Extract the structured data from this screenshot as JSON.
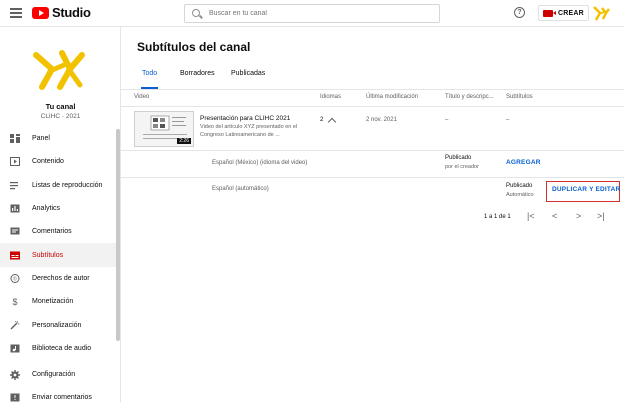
{
  "topbar": {
    "logo_text": "Studio",
    "search_placeholder": "Buscar en tu canal",
    "help_glyph": "?",
    "create_label": "CREAR"
  },
  "sidebar": {
    "channel_name": "Tu canal",
    "channel_handle": "CLIHC · 2021",
    "items": [
      {
        "label": "Panel",
        "icon": "dashboard-icon",
        "active": false
      },
      {
        "label": "Contenido",
        "icon": "content-icon",
        "active": false
      },
      {
        "label": "Listas de reproducción",
        "icon": "playlist-icon",
        "active": false
      },
      {
        "label": "Analytics",
        "icon": "analytics-icon",
        "active": false
      },
      {
        "label": "Comentarios",
        "icon": "comments-icon",
        "active": false
      },
      {
        "label": "Subtítulos",
        "icon": "subtitles-icon",
        "active": true
      },
      {
        "label": "Derechos de autor",
        "icon": "copyright-icon",
        "active": false
      },
      {
        "label": "Monetización",
        "icon": "monetization-icon",
        "active": false
      },
      {
        "label": "Personalización",
        "icon": "customization-icon",
        "active": false
      },
      {
        "label": "Biblioteca de audio",
        "icon": "audio-library-icon",
        "active": false
      },
      {
        "label": "Configuración",
        "icon": "settings-icon",
        "active": false
      },
      {
        "label": "Enviar comentarios",
        "icon": "feedback-icon",
        "active": false
      }
    ]
  },
  "main": {
    "title": "Subtítulos del canal",
    "tabs": [
      "Todo",
      "Borradores",
      "Publicadas"
    ],
    "columns": {
      "video": "Video",
      "languages": "Idiomas",
      "last_modified": "Última modificación",
      "title_desc": "Título y descripc...",
      "subtitles": "Subtítulos"
    },
    "video_row": {
      "title": "Presentación para CLIHC 2021",
      "description": "Video del artículo XYZ presentado en el Congreso Latinoamericano de ...",
      "duration": "2:26",
      "languages_count": "2",
      "last_modified": "2 nov. 2021",
      "title_desc_value": "–",
      "subtitles_value": "–"
    },
    "lang_rows": [
      {
        "language": "Español (México) (idioma del video)",
        "status": "Publicado",
        "status_sub": "por el creador",
        "action": "AGREGAR"
      },
      {
        "language": "Español (automático)",
        "status": "Publicado",
        "status_sub": "Automático",
        "action": "DUPLICAR Y EDITAR"
      }
    ],
    "pagination": {
      "range": "1 a 1 de 1",
      "first": "|<",
      "prev": "<",
      "next": ">",
      "last": ">|"
    }
  },
  "colors": {
    "accent_blue": "#065fd4",
    "brand_red": "#ff0000",
    "active_red": "#cc0000",
    "highlight_box": "#d32f2f"
  }
}
